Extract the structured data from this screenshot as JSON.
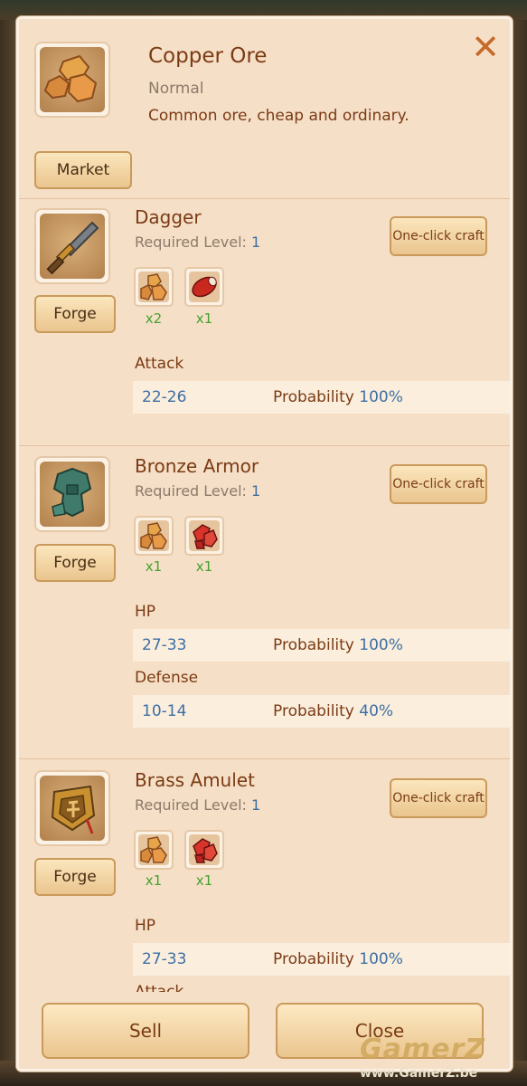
{
  "header": {
    "title": "Copper Ore",
    "rarity": "Normal",
    "description": "Common ore, cheap and ordinary.",
    "market_button": "Market"
  },
  "items": [
    {
      "name": "Dagger",
      "required_label": "Required Level:",
      "required_level": "1",
      "craft_button": "One-click craft",
      "forge_button": "Forge",
      "materials": [
        {
          "icon": "copper-ore-icon",
          "qty": "x2"
        },
        {
          "icon": "meat-icon",
          "qty": "x1"
        }
      ],
      "stats": [
        {
          "label": "Attack",
          "range": "22-26",
          "prob_label": "Probability",
          "prob_value": "100%"
        }
      ]
    },
    {
      "name": "Bronze Armor",
      "required_label": "Required Level:",
      "required_level": "1",
      "craft_button": "One-click craft",
      "forge_button": "Forge",
      "materials": [
        {
          "icon": "copper-ore-icon",
          "qty": "x1"
        },
        {
          "icon": "red-crystal-icon",
          "qty": "x1"
        }
      ],
      "stats": [
        {
          "label": "HP",
          "range": "27-33",
          "prob_label": "Probability",
          "prob_value": "100%"
        },
        {
          "label": "Defense",
          "range": "10-14",
          "prob_label": "Probability",
          "prob_value": "40%"
        }
      ]
    },
    {
      "name": "Brass Amulet",
      "required_label": "Required Level:",
      "required_level": "1",
      "craft_button": "One-click craft",
      "forge_button": "Forge",
      "materials": [
        {
          "icon": "copper-ore-icon",
          "qty": "x1"
        },
        {
          "icon": "red-crystal-icon",
          "qty": "x1"
        }
      ],
      "stats": [
        {
          "label": "HP",
          "range": "27-33",
          "prob_label": "Probability",
          "prob_value": "100%"
        },
        {
          "label": "Attack",
          "range": "",
          "prob_label": "",
          "prob_value": ""
        }
      ]
    }
  ],
  "footer": {
    "sell": "Sell",
    "close": "Close"
  },
  "watermark": {
    "brand": "GamerZ",
    "url": "www.GamerZ.be"
  },
  "colors": {
    "panel": "#f6dfc7",
    "title": "#7a3b14",
    "value": "#3d6fa4",
    "qty": "#44a230",
    "close_x": "#c66a2c"
  }
}
